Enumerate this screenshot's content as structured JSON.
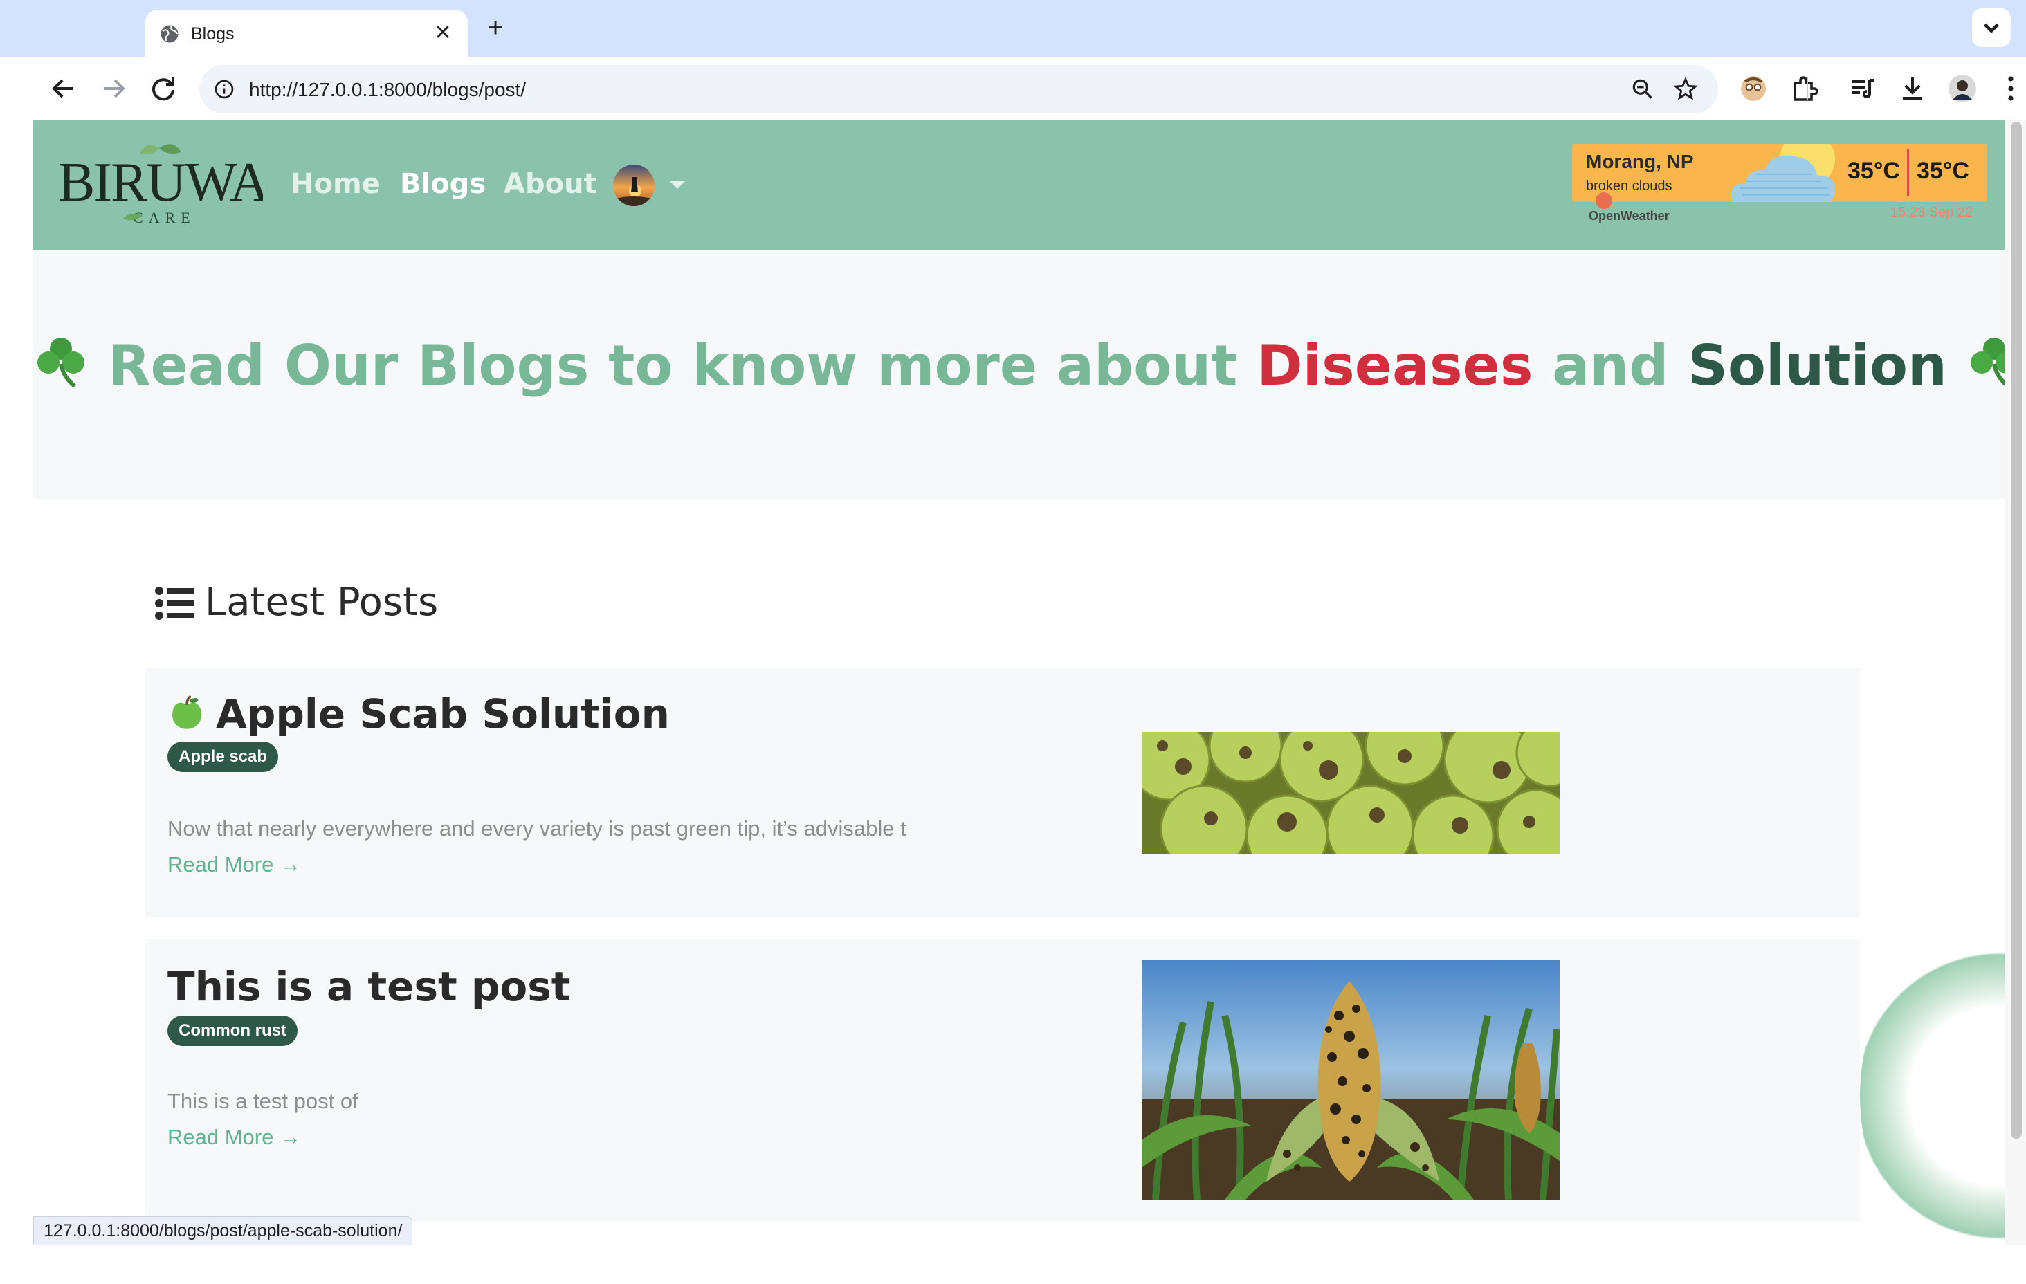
{
  "browser": {
    "tab_title": "Blogs",
    "tab_close": "✕",
    "new_tab": "+",
    "url": "http://127.0.0.1:8000/blogs/post/",
    "status_url": "127.0.0.1:8000/blogs/post/apple-scab-solution/"
  },
  "site": {
    "logo_text": "BIRUWA",
    "logo_subtext": "CARE",
    "nav": {
      "home": "Home",
      "blogs": "Blogs",
      "about": "About"
    }
  },
  "weather": {
    "location": "Morang, NP",
    "description": "broken clouds",
    "temp_primary": "35°C",
    "temp_secondary": "35°C",
    "provider": "OpenWeather",
    "timestamp": "15:23 Sep 22"
  },
  "hero": {
    "part1": "Read Our Blogs to know more about ",
    "diseases": "Diseases",
    "part2": " and ",
    "solution": "Solution"
  },
  "latest": {
    "title": "Latest Posts"
  },
  "posts": [
    {
      "title": "Apple Scab Solution",
      "tag": "Apple scab",
      "excerpt": "Now that nearly everywhere and every variety is past green tip, it’s advisable t",
      "read_more": "Read More →"
    },
    {
      "title": "This is a test post",
      "tag": "Common rust",
      "excerpt": "This is a test post of",
      "read_more": "Read More →"
    }
  ],
  "colors": {
    "navbar": "#8bc2ab",
    "hero_green": "#78b898",
    "hero_red": "#d0303e",
    "hero_dark": "#2e5848",
    "badge": "#2e5848",
    "link": "#5fb48d",
    "weather_bg": "#f8b64c"
  }
}
